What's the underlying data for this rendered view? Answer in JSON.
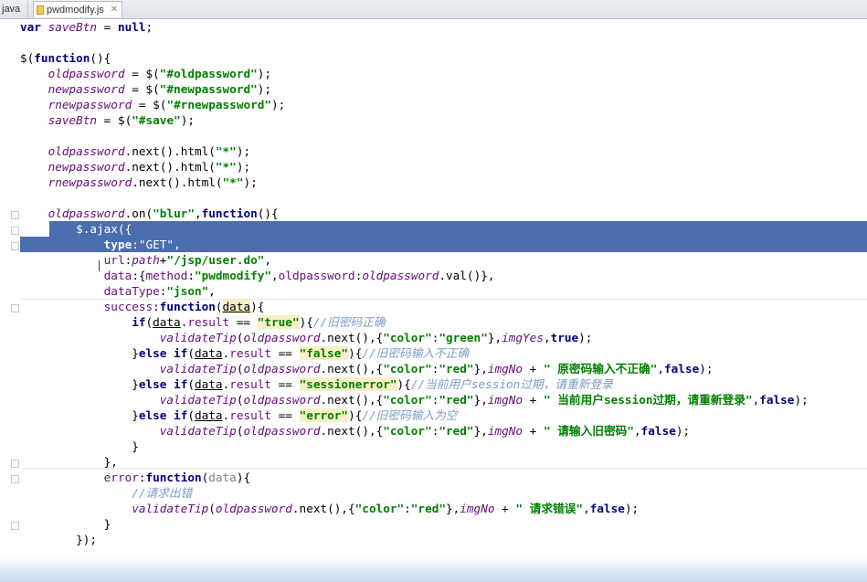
{
  "tabs": [
    {
      "label": "java",
      "active": false
    },
    {
      "label": "pwdmodify.js",
      "active": true
    }
  ],
  "editor": {
    "lines": [
      "var saveBtn = null;",
      "",
      "$(function(){",
      "oldpassword = $(\"#oldpassword\");",
      "newpassword = $(\"#newpassword\");",
      "rnewpassword = $(\"#rnewpassword\");",
      "saveBtn = $(\"#save\");",
      "",
      "oldpassword.next().html(\"*\");",
      "newpassword.next().html(\"*\");",
      "rnewpassword.next().html(\"*\");",
      "",
      "oldpassword.on(\"blur\",function(){",
      "$.ajax({",
      "type:\"GET\",",
      "url:path+\"/jsp/user.do\",",
      "data:{method:\"pwdmodify\",oldpassword:oldpassword.val()},",
      "dataType:\"json\",",
      "success:function(data){",
      "if(data.result == \"true\"){//旧密码正确",
      "validateTip(oldpassword.next(),{\"color\":\"green\"},imgYes,true);",
      "}else if(data.result == \"false\"){//旧密码输入不正确",
      "validateTip(oldpassword.next(),{\"color\":\"red\"},imgNo + \" 原密码输入不正确\",false);",
      "}else if(data.result == \"sessionerror\"){//当前用户session过期，请重新登录",
      "validateTip(oldpassword.next(),{\"color\":\"red\"},imgNo + \" 当前用户session过期，请重新登录\",false);",
      "}else if(data.result == \"error\"){//旧密码输入为空",
      "validateTip(oldpassword.next(),{\"color\":\"red\"},imgNo + \" 请输入旧密码\",false);",
      "}",
      "},",
      "error:function(data){",
      "//请求出错",
      "validateTip(oldpassword.next(),{\"color\":\"red\"},imgNo + \" 请求错误\",false);",
      "}",
      "});"
    ]
  },
  "colors": {
    "selection": "#4b6eaf",
    "keyword": "#000080",
    "string": "#008000",
    "variable": "#660e7a",
    "comment": "#808080"
  }
}
